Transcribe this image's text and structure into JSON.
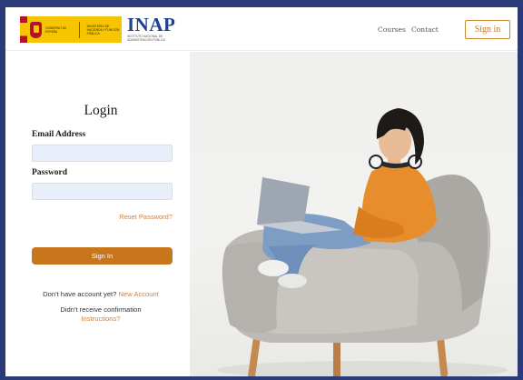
{
  "header": {
    "gov_logo_text_left": "Gobierno de España",
    "gov_logo_text_right": "Ministerio de Hacienda y Función Pública",
    "brand": "INAP",
    "brand_subtitle": "Instituto Nacional de Administración Pública",
    "nav": [
      {
        "label": "Courses"
      },
      {
        "label": "Contact"
      }
    ],
    "sign_in_label": "Sign in",
    "brand_color": "#1f3f8f",
    "accent_color": "#c8761d"
  },
  "login": {
    "title": "Login",
    "email_label": "Email Address",
    "email_value": "",
    "password_label": "Password",
    "password_value": "",
    "reset_link": "Reset Password?",
    "submit_label": "Sign In",
    "no_account_text": "Don't have account yet?",
    "new_account_link": "New Account",
    "no_confirmation_text": "Didn't receive confirmation",
    "instructions_link": "Instructions?"
  },
  "hero": {
    "icon": "woman-with-laptop-in-armchair-illustration"
  }
}
